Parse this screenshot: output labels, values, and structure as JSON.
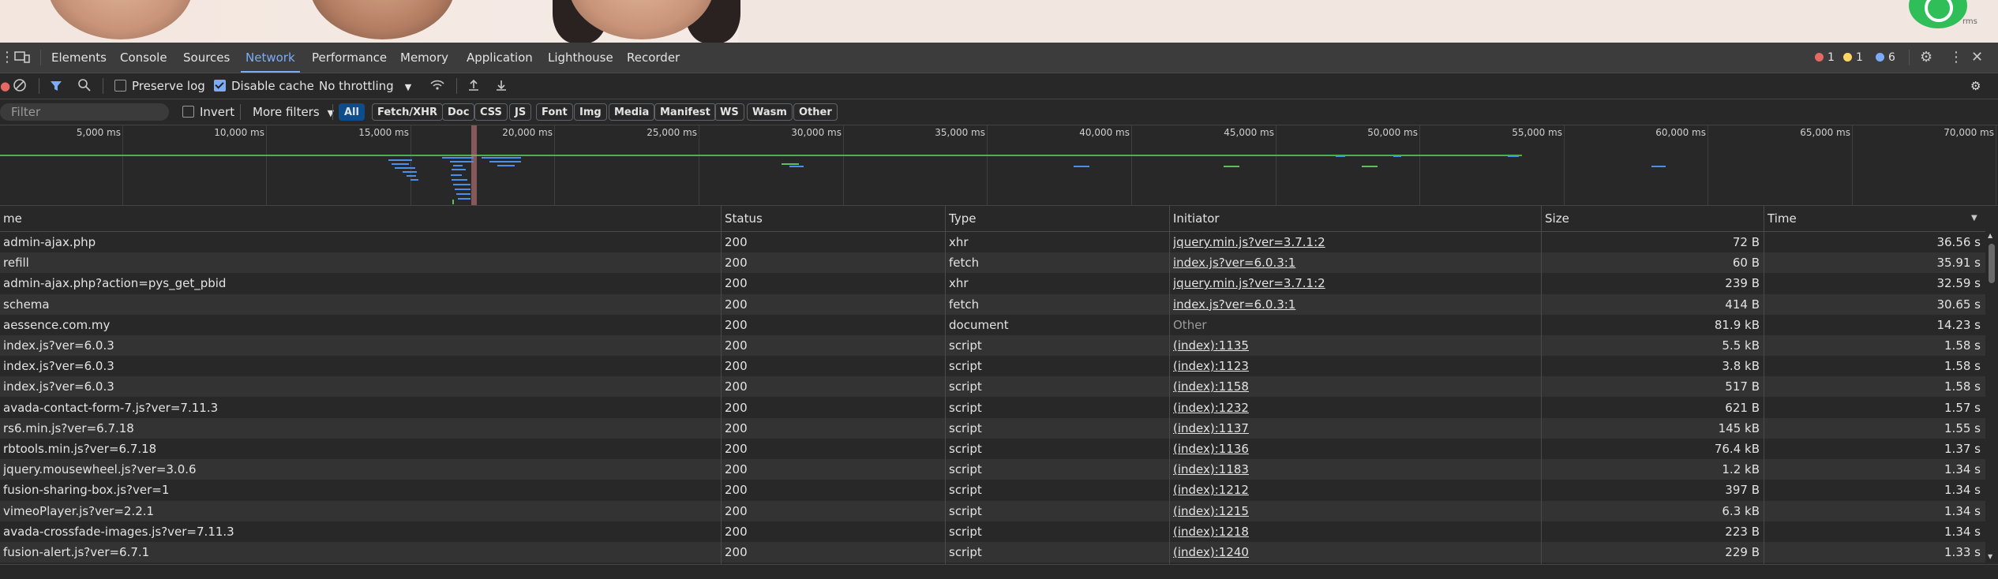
{
  "devtools": {
    "tabs": [
      "Elements",
      "Console",
      "Sources",
      "Network",
      "Performance",
      "Memory",
      "Application",
      "Lighthouse",
      "Recorder"
    ],
    "active_tab": "Network",
    "errors": "1",
    "warnings": "1",
    "messages": "6"
  },
  "toolbar": {
    "preserve_log": "Preserve log",
    "disable_cache": "Disable cache",
    "throttling": "No throttling"
  },
  "filterbar": {
    "placeholder": "Filter",
    "invert": "Invert",
    "more_filters": "More filters",
    "types": [
      "All",
      "Fetch/XHR",
      "Doc",
      "CSS",
      "JS",
      "Font",
      "Img",
      "Media",
      "Manifest",
      "WS",
      "Wasm",
      "Other"
    ],
    "selected_type": "All"
  },
  "overview": {
    "ticks": [
      "5,000 ms",
      "10,000 ms",
      "15,000 ms",
      "20,000 ms",
      "25,000 ms",
      "30,000 ms",
      "35,000 ms",
      "40,000 ms",
      "45,000 ms",
      "50,000 ms",
      "55,000 ms",
      "60,000 ms",
      "65,000 ms",
      "70,000 ms"
    ]
  },
  "table": {
    "columns": [
      "me",
      "Status",
      "Type",
      "Initiator",
      "Size",
      "Time"
    ],
    "rows": [
      {
        "name": "admin-ajax.php",
        "status": "200",
        "type": "xhr",
        "initiator": "jquery.min.js?ver=3.7.1:2",
        "size": "72 B",
        "time": "36.56 s"
      },
      {
        "name": "refill",
        "status": "200",
        "type": "fetch",
        "initiator": "index.js?ver=6.0.3:1",
        "size": "60 B",
        "time": "35.91 s"
      },
      {
        "name": "admin-ajax.php?action=pys_get_pbid",
        "status": "200",
        "type": "xhr",
        "initiator": "jquery.min.js?ver=3.7.1:2",
        "size": "239 B",
        "time": "32.59 s"
      },
      {
        "name": "schema",
        "status": "200",
        "type": "fetch",
        "initiator": "index.js?ver=6.0.3:1",
        "size": "414 B",
        "time": "30.65 s"
      },
      {
        "name": "aessence.com.my",
        "status": "200",
        "type": "document",
        "initiator": "Other",
        "size": "81.9 kB",
        "time": "14.23 s"
      },
      {
        "name": "index.js?ver=6.0.3",
        "status": "200",
        "type": "script",
        "initiator": "(index):1135",
        "size": "5.5 kB",
        "time": "1.58 s"
      },
      {
        "name": "index.js?ver=6.0.3",
        "status": "200",
        "type": "script",
        "initiator": "(index):1123",
        "size": "3.8 kB",
        "time": "1.58 s"
      },
      {
        "name": "index.js?ver=6.0.3",
        "status": "200",
        "type": "script",
        "initiator": "(index):1158",
        "size": "517 B",
        "time": "1.58 s"
      },
      {
        "name": "avada-contact-form-7.js?ver=7.11.3",
        "status": "200",
        "type": "script",
        "initiator": "(index):1232",
        "size": "621 B",
        "time": "1.57 s"
      },
      {
        "name": "rs6.min.js?ver=6.7.18",
        "status": "200",
        "type": "script",
        "initiator": "(index):1137",
        "size": "145 kB",
        "time": "1.55 s"
      },
      {
        "name": "rbtools.min.js?ver=6.7.18",
        "status": "200",
        "type": "script",
        "initiator": "(index):1136",
        "size": "76.4 kB",
        "time": "1.37 s"
      },
      {
        "name": "jquery.mousewheel.js?ver=3.0.6",
        "status": "200",
        "type": "script",
        "initiator": "(index):1183",
        "size": "1.2 kB",
        "time": "1.34 s"
      },
      {
        "name": "fusion-sharing-box.js?ver=1",
        "status": "200",
        "type": "script",
        "initiator": "(index):1212",
        "size": "397 B",
        "time": "1.34 s"
      },
      {
        "name": "vimeoPlayer.js?ver=2.2.1",
        "status": "200",
        "type": "script",
        "initiator": "(index):1215",
        "size": "6.3 kB",
        "time": "1.34 s"
      },
      {
        "name": "avada-crossfade-images.js?ver=7.11.3",
        "status": "200",
        "type": "script",
        "initiator": "(index):1218",
        "size": "223 B",
        "time": "1.34 s"
      },
      {
        "name": "fusion-alert.js?ver=6.7.1",
        "status": "200",
        "type": "script",
        "initiator": "(index):1240",
        "size": "229 B",
        "time": "1.33 s"
      }
    ]
  },
  "page": {
    "widget_label": "rms"
  }
}
